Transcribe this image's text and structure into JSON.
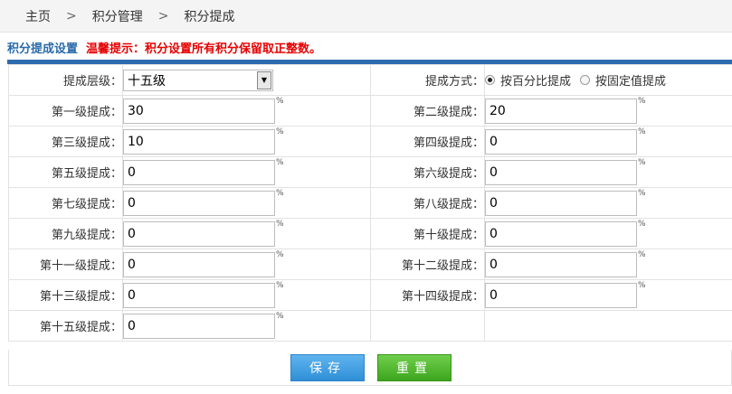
{
  "breadcrumb": {
    "home": "主页",
    "sep": ">",
    "level1": "积分管理",
    "level2": "积分提成"
  },
  "section": {
    "title": "积分提成设置",
    "tip": "温馨提示：积分设置所有积分保留取正整数。"
  },
  "form": {
    "level_label": "提成层级：",
    "level_value": "十五级",
    "method_label": "提成方式：",
    "method_options": [
      "按百分比提成",
      "按固定值提成"
    ],
    "method_selected": "按百分比提成",
    "percent_sign": "%",
    "rows": [
      {
        "left_label": "第一级提成：",
        "left_value": "30",
        "right_label": "第二级提成：",
        "right_value": "20"
      },
      {
        "left_label": "第三级提成：",
        "left_value": "10",
        "right_label": "第四级提成：",
        "right_value": "0"
      },
      {
        "left_label": "第五级提成：",
        "left_value": "0",
        "right_label": "第六级提成：",
        "right_value": "0"
      },
      {
        "left_label": "第七级提成：",
        "left_value": "0",
        "right_label": "第八级提成：",
        "right_value": "0"
      },
      {
        "left_label": "第九级提成：",
        "left_value": "0",
        "right_label": "第十级提成：",
        "right_value": "0"
      },
      {
        "left_label": "第十一级提成：",
        "left_value": "0",
        "right_label": "第十二级提成：",
        "right_value": "0"
      },
      {
        "left_label": "第十三级提成：",
        "left_value": "0",
        "right_label": "第十四级提成：",
        "right_value": "0"
      },
      {
        "left_label": "第十五级提成：",
        "left_value": "0"
      }
    ]
  },
  "buttons": {
    "save": "保存",
    "reset": "重置"
  }
}
